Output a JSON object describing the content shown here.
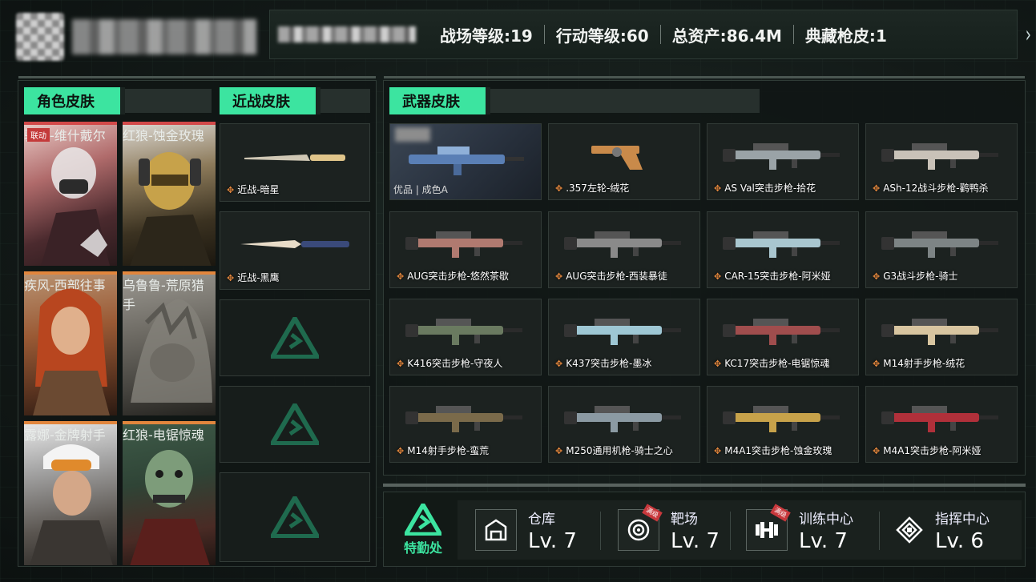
{
  "header": {
    "stats": [
      {
        "label": "战场等级:",
        "value": "19"
      },
      {
        "label": "行动等级:",
        "value": "60"
      },
      {
        "label": "总资产:",
        "value": "86.4M"
      },
      {
        "label": "典藏枪皮:",
        "value": "1"
      }
    ],
    "next_icon": "chevron-right-icon"
  },
  "role_skins": {
    "title": "角色皮肤",
    "items": [
      {
        "tag": "联动",
        "label": "骇爪-维什戴尔"
      },
      {
        "label": "红狼-蚀金玫瑰"
      },
      {
        "label": "疾风-西部往事"
      },
      {
        "label": "乌鲁鲁-荒原猎手"
      },
      {
        "label": "露娜-金牌射手"
      },
      {
        "label": "红狼-电锯惊魂"
      }
    ]
  },
  "melee_skins": {
    "title": "近战皮肤",
    "items": [
      {
        "label": "近战-暗星"
      },
      {
        "label": "近战-黑鹰"
      }
    ]
  },
  "weapon_skins": {
    "title": "武器皮肤",
    "featured": {
      "rarity": "优品 | 成色A"
    },
    "items": [
      {
        "label": ".357左轮-绒花"
      },
      {
        "label": "AS Val突击步枪-拾花"
      },
      {
        "label": "ASh-12战斗步枪-鹳鸭杀"
      },
      {
        "label": "AUG突击步枪-悠然茶歇"
      },
      {
        "label": "AUG突击步枪-西装暴徒"
      },
      {
        "label": "CAR-15突击步枪-阿米娅"
      },
      {
        "label": "G3战斗步枪-骑士"
      },
      {
        "label": "K416突击步枪-守夜人"
      },
      {
        "label": "K437突击步枪-墨冰"
      },
      {
        "label": "KC17突击步枪-电锯惊魂"
      },
      {
        "label": "M14射手步枪-绒花"
      },
      {
        "label": "M14射手步枪-蛮荒"
      },
      {
        "label": "M250通用机枪-骑士之心"
      },
      {
        "label": "M4A1突击步枪-蚀金玫瑰"
      },
      {
        "label": "M4A1突击步枪-阿米娅"
      }
    ]
  },
  "facilities": {
    "hq_label": "特勤处",
    "items": [
      {
        "name": "仓库",
        "level": "Lv. 7",
        "icon": "warehouse-icon"
      },
      {
        "name": "靶场",
        "level": "Lv. 7",
        "icon": "target-icon",
        "badge": "满级"
      },
      {
        "name": "训练中心",
        "level": "Lv. 7",
        "icon": "dumbbell-icon",
        "badge": "满级"
      },
      {
        "name": "指挥中心",
        "level": "Lv. 6",
        "icon": "command-icon"
      }
    ]
  },
  "colors": {
    "accent": "#3ce4a0",
    "orange": "#e2863d",
    "red": "#d24949"
  }
}
